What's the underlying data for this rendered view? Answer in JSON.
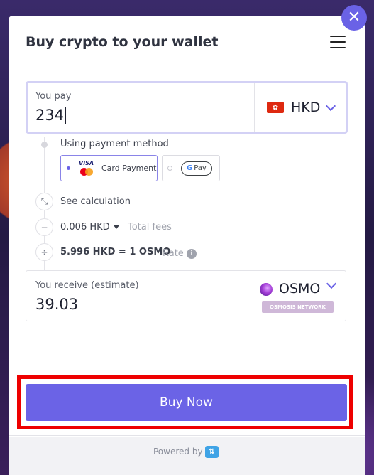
{
  "header": {
    "title": "Buy crypto to your wallet"
  },
  "pay": {
    "label": "You pay",
    "amount": "234",
    "currency": "HKD"
  },
  "payment_method": {
    "label": "Using payment method",
    "options": [
      {
        "label": "Card Payment",
        "selected": true,
        "card_brand": "VISA"
      },
      {
        "label": "Pay",
        "selected": false,
        "brand": "G Pay"
      }
    ]
  },
  "calculation": {
    "toggle_label": "See calculation",
    "fee_value": "0.006 HKD",
    "fee_label": "Total fees",
    "rate_value": "5.996 HKD = 1 OSMO",
    "rate_label": "Rate"
  },
  "receive": {
    "label": "You receive (estimate)",
    "amount": "39.03",
    "crypto": "OSMO",
    "network": "OSMOSIS NETWORK"
  },
  "actions": {
    "buy_label": "Buy Now"
  },
  "footer": {
    "powered_by": "Powered by"
  },
  "colors": {
    "accent": "#6b63e6",
    "highlight": "#ee0000",
    "hk_flag": "#de2910"
  }
}
